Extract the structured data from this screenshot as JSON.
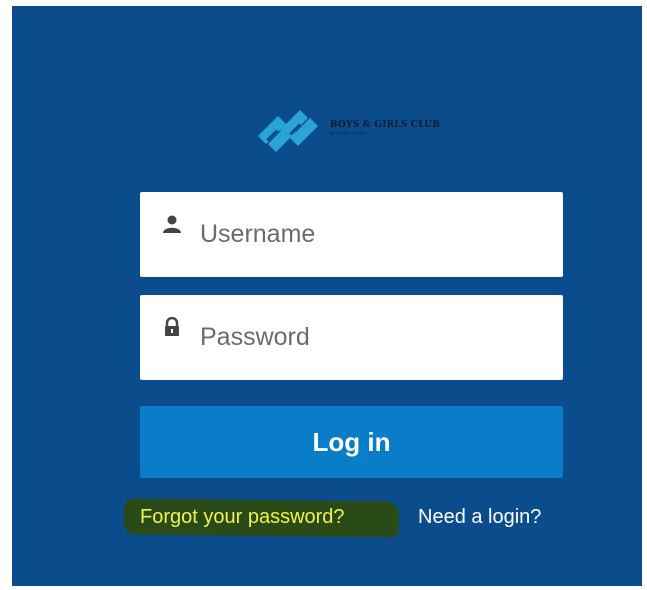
{
  "brand": {
    "name": "BOYS & GIRLS CLUB",
    "subtitle": "OF LOWE COUNTY",
    "logo_icon": "club-logo-icon"
  },
  "form": {
    "username": {
      "placeholder": "Username",
      "value": "",
      "icon": "user-icon"
    },
    "password": {
      "placeholder": "Password",
      "value": "",
      "icon": "lock-icon"
    },
    "login_label": "Log in"
  },
  "links": {
    "forgot_password": "Forgot your password?",
    "need_login": "Need a login?"
  },
  "colors": {
    "background": "#0b4d8c",
    "button": "#0a7dc9",
    "logo": "#2aa3d6",
    "forgot_link": "#f2f24a",
    "highlight": "#2a4a18"
  }
}
